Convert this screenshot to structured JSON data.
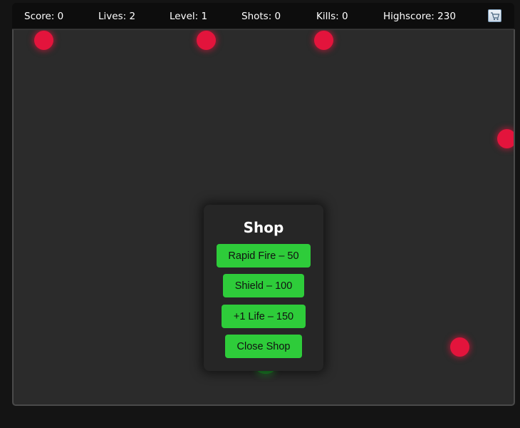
{
  "hud": {
    "score": "Score: 0",
    "lives": "Lives: 2",
    "level": "Level: 1",
    "shots": "Shots: 0",
    "kills": "Kills: 0",
    "highscore": "Highscore: 230",
    "shop_toggle_icon": "cart-icon"
  },
  "shop": {
    "title": "Shop",
    "items": [
      {
        "label": "Rapid Fire – 50"
      },
      {
        "label": "Shield – 100"
      },
      {
        "label": "+1 Life – 150"
      }
    ],
    "close_label": "Close Shop",
    "button_color": "#2ecc3a"
  },
  "arena": {
    "enemy_color": "#e3143c",
    "player_color": "#1e8a2a",
    "background_color": "#2b2b2b"
  }
}
